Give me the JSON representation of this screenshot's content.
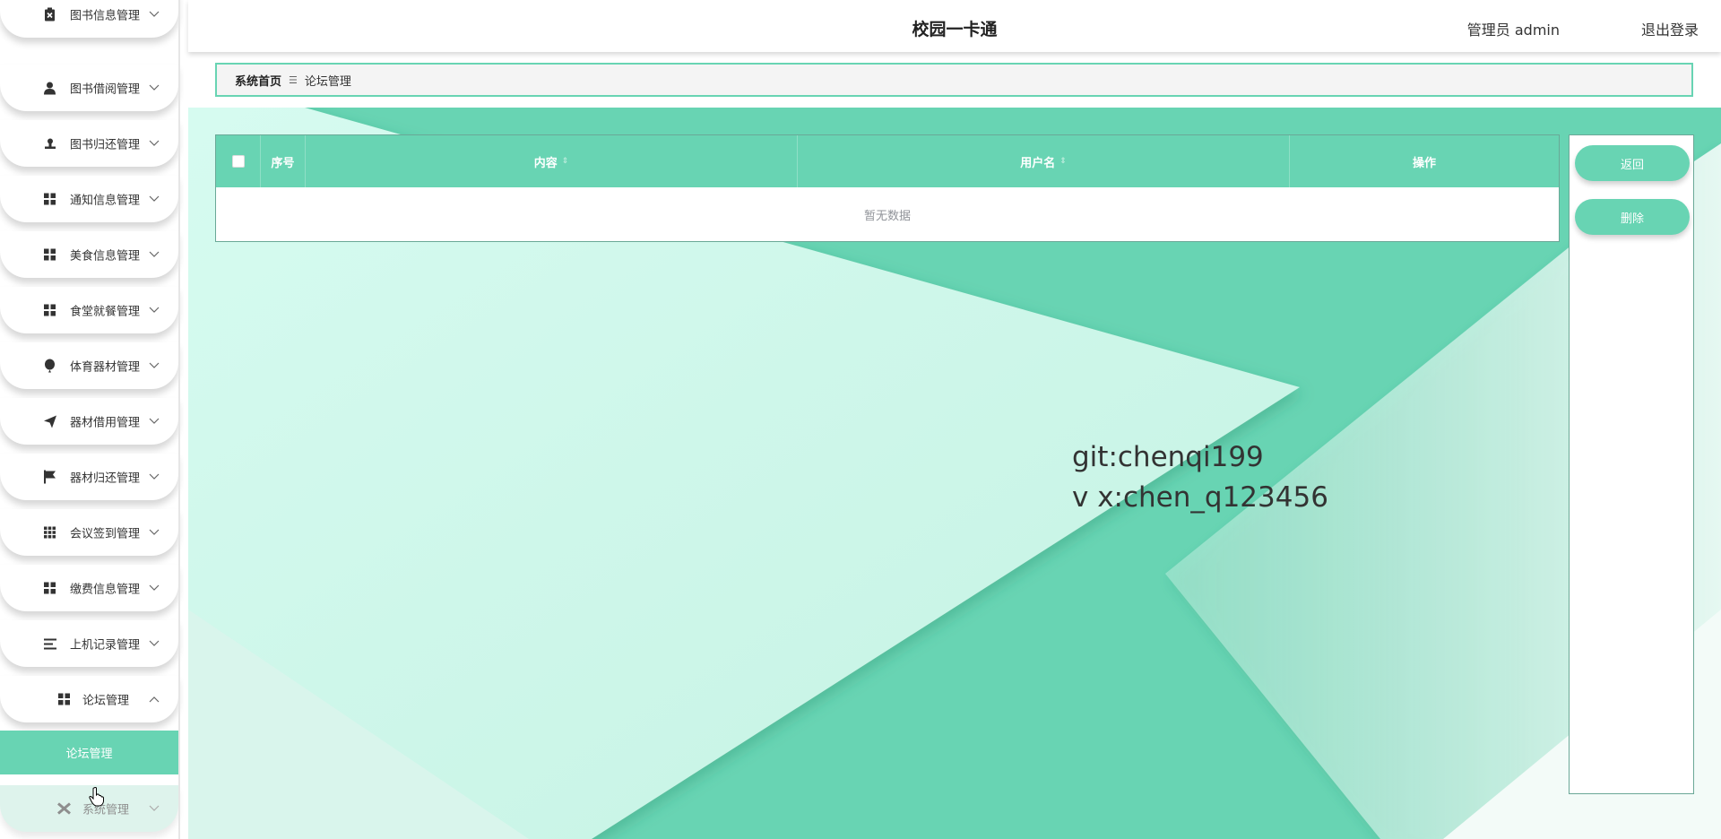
{
  "app_title": "校园一卡通",
  "header": {
    "user": "管理员 admin",
    "logout": "退出登录"
  },
  "breadcrumb": {
    "home": "系统首页",
    "separator": "☰",
    "current": "论坛管理"
  },
  "sidebar": {
    "items": [
      {
        "label": "图书信息管理",
        "icon": "clipboard-x-icon"
      },
      {
        "label": "图书借阅管理",
        "icon": "user-icon"
      },
      {
        "label": "图书归还管理",
        "icon": "stamp-icon"
      },
      {
        "label": "通知信息管理",
        "icon": "grid-icon"
      },
      {
        "label": "美食信息管理",
        "icon": "grid-icon"
      },
      {
        "label": "食堂就餐管理",
        "icon": "grid-icon"
      },
      {
        "label": "体育器材管理",
        "icon": "balloon-icon"
      },
      {
        "label": "器材借用管理",
        "icon": "paper-plane-icon"
      },
      {
        "label": "器材归还管理",
        "icon": "flag-icon"
      },
      {
        "label": "会议签到管理",
        "icon": "grid-nine-icon"
      },
      {
        "label": "缴费信息管理",
        "icon": "grid-icon"
      },
      {
        "label": "上机记录管理",
        "icon": "list-icon"
      },
      {
        "label": "论坛管理",
        "icon": "grid-icon"
      },
      {
        "label": "系统管理",
        "icon": "tools-icon"
      }
    ],
    "submenu": {
      "label": "论坛管理"
    }
  },
  "table": {
    "columns": [
      {
        "label": ""
      },
      {
        "label": "序号"
      },
      {
        "label": "内容",
        "sortable": true
      },
      {
        "label": "用户名",
        "sortable": true
      },
      {
        "label": "操作"
      }
    ],
    "empty_text": "暂无数据"
  },
  "actions": {
    "back": "返回",
    "delete": "删除"
  },
  "watermark": {
    "line1": "git:chenqi199",
    "line2": "v x:chen_q123456"
  },
  "colors": {
    "accent": "#68d4b3",
    "accent_light": "#c7f5e6"
  }
}
